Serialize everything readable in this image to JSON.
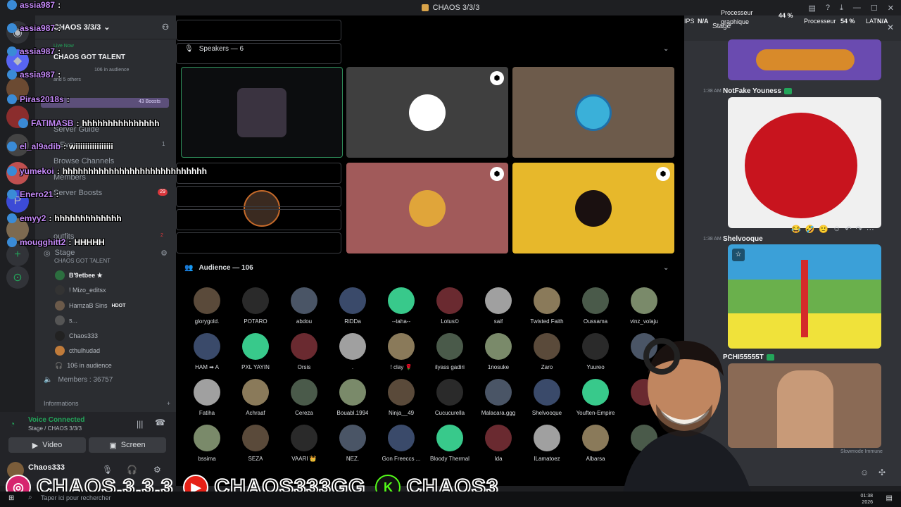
{
  "window": {
    "title": "CHAOS 3/3/3"
  },
  "server": {
    "name": "CHAOS 3/3/3",
    "event_badge": "Live Now",
    "event_title": "CHAOS GOT TALENT",
    "event_audience": "106 in audience",
    "event_stage": "Stage",
    "event_speakers": "and 5 others",
    "boosts": "43 Boosts",
    "server_guide": "Server Guide",
    "events": "1 Event",
    "events_count": "1",
    "browse_channels": "Browse Channels",
    "members_label": "Members",
    "server_boosts": "Server Boosts",
    "server_boosts_count": "29",
    "outfits": "outfits",
    "outfits_count": "2"
  },
  "stage_channel": {
    "name": "Stage",
    "subtitle": "CHAOS GOT TALENT",
    "users": [
      "B'9etbee ★",
      "! Mizo_editsx",
      "HamzaB Sins",
      "s...",
      "Chaos333",
      "cthulhudad"
    ],
    "user_tag": "HDOT",
    "audience_count": "106 in audience"
  },
  "members": "Members : 36757",
  "informations": "Informations",
  "voice": {
    "status": "Voice Connected",
    "location": "Stage / CHAOS 3/3/3",
    "video_label": "Video",
    "screen_label": "Screen"
  },
  "user_panel": {
    "name": "Chaos333"
  },
  "stage_main": {
    "speakers_label": "Speakers — 6",
    "audience_label": "Audience — 106",
    "audience": [
      [
        "glorygold.",
        "POTARO",
        "abdou",
        "RiDDa",
        "--taha--",
        "Lotus©",
        "saif",
        "Twisted Faith",
        "Oussama",
        "vinz_volaju"
      ],
      [
        "HAM ➡ A",
        "PXL YAYIN",
        "Orsis",
        ".",
        "! clay 🌹",
        "ilyass gadiri",
        "1nosuke",
        "Zaro",
        "Yuureo",
        ""
      ],
      [
        "Fatiha",
        "Achraaf",
        "Cereza",
        "Bouabl.1994",
        "Ninja__49",
        "Cucucurella",
        "Malacara.ggg",
        "Shelvooque",
        "Youften-Empire",
        ""
      ],
      [
        "bssima",
        "SEZA",
        "VAARI 👑",
        "NEZ.",
        "Gon Freeccs ...",
        "Bloody Thermal",
        "Ida",
        "ILamatoez",
        "Albarsa",
        ""
      ]
    ]
  },
  "chat": {
    "header": "Stage",
    "messages": [
      {
        "time": "1:38 AM",
        "author": "NotFake Youness"
      },
      {
        "time": "1:38 AM",
        "author": "Shelvooque"
      },
      {
        "time": "1:38 AM",
        "author": "PCHI55555T"
      }
    ],
    "slowmode": "Slowmode Immune"
  },
  "hud": {
    "ips": "IPS",
    "ips_val": "N/A",
    "proc_graph": "Processeur graphique",
    "proc_graph_val": "44 %",
    "proc": "Processeur",
    "proc_val": "54 %",
    "lat": "LAT",
    "lat_val": "N/A"
  },
  "overlay_chat": [
    {
      "user": "assia987",
      "msg": ""
    },
    {
      "user": "assia987",
      "msg": ""
    },
    {
      "user": "assia987",
      "msg": ""
    },
    {
      "user": "assia987",
      "msg": ""
    },
    {
      "user": "Piras2018s",
      "msg": ""
    },
    {
      "user": "FATIMASB",
      "msg": "hhhhhhhhhhhhhhh"
    },
    {
      "user": "el_al9adib",
      "msg": "wiiiiiiiiiiiiiiii"
    },
    {
      "user": "yumekoi",
      "msg": "hhhhhhhhhhhhhhhhhhhhhhhhhhhh"
    },
    {
      "user": "Enero21",
      "msg": ""
    },
    {
      "user": "emyy2",
      "msg": "hhhhhhhhhhhhh"
    },
    {
      "user": "mougghitt2",
      "msg": "HHHHH"
    }
  ],
  "banner": {
    "instagram": "CHAOS.3.3.3",
    "youtube": "CHAOS333GG",
    "kick": "CHAOS3"
  },
  "taskbar": {
    "search_placeholder": "Taper ici pour rechercher",
    "time": "01:38",
    "date": "2026"
  },
  "colors": {
    "accent_green": "#23a55a",
    "overlay_user": "#c58af9",
    "tile_red": "#a15a5a",
    "tile_yellow": "#e7b82b",
    "tile_brown": "#6d5b4b",
    "tile_gray": "#3f3f3f"
  }
}
